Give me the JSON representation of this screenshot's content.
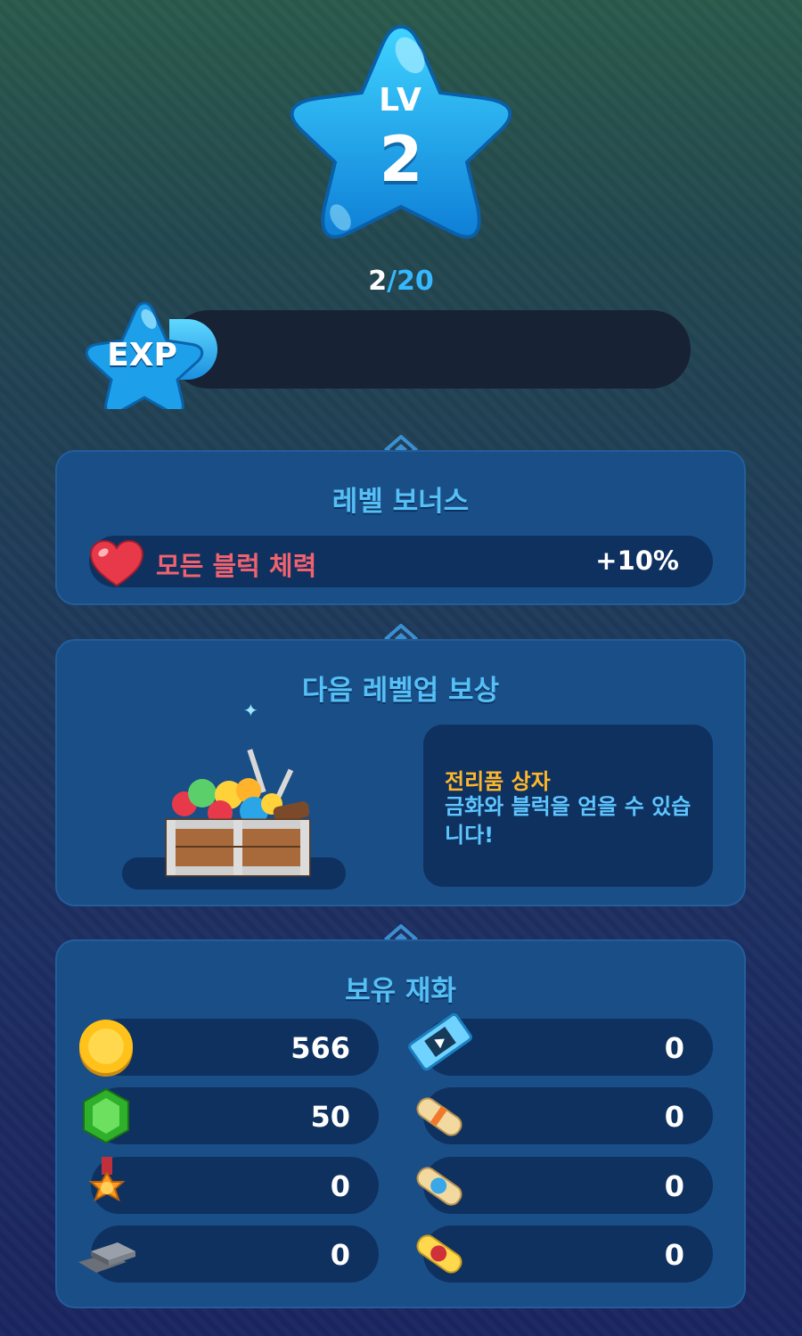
{
  "level": {
    "label": "LV",
    "value": "2"
  },
  "exp": {
    "current": "2",
    "separator": "/",
    "max": "20",
    "badge_label": "EXP",
    "progress": 0.1
  },
  "bonus_panel": {
    "title": "레벨 보너스",
    "item": {
      "name": "모든 블럭 체력",
      "value": "+10%",
      "icon": "heart-icon"
    }
  },
  "reward_panel": {
    "title": "다음 레벨업 보상",
    "reward": {
      "name": "전리품 상자",
      "description": "금화와 블럭을 얻을 수 있습니다!",
      "icon": "treasure-chest-icon"
    }
  },
  "currency_panel": {
    "title": "보유 재화",
    "left": [
      {
        "icon": "gold-coin-icon",
        "value": "566"
      },
      {
        "icon": "green-gem-icon",
        "value": "50"
      },
      {
        "icon": "medal-icon",
        "value": "0"
      },
      {
        "icon": "silver-ingot-icon",
        "value": "0"
      }
    ],
    "right": [
      {
        "icon": "video-ticket-icon",
        "value": "0"
      },
      {
        "icon": "orange-scroll-icon",
        "value": "0"
      },
      {
        "icon": "blue-scroll-icon",
        "value": "0"
      },
      {
        "icon": "red-scroll-icon",
        "value": "0"
      }
    ]
  },
  "colors": {
    "accent": "#55c0f5",
    "bonus_text": "#f2626e",
    "reward_name": "#ffb72a",
    "panel": "#1a4e87",
    "row": "#0f3160"
  }
}
